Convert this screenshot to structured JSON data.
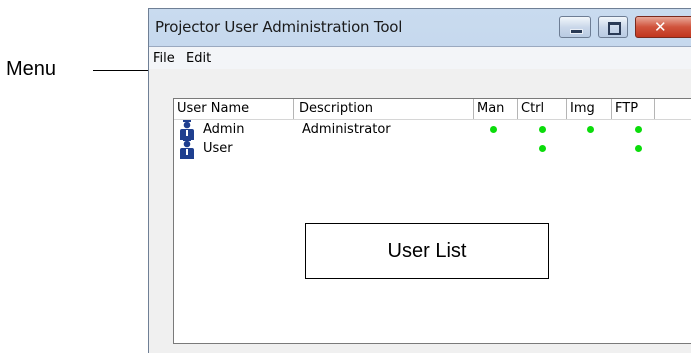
{
  "annotations": {
    "menu_callout": "Menu",
    "user_list_callout": "User List"
  },
  "window": {
    "title": "Projector User Administration Tool",
    "close_glyph": "✕"
  },
  "menubar": {
    "items": [
      "File",
      "Edit"
    ]
  },
  "user_list": {
    "columns": [
      "User Name",
      "Description",
      "Man",
      "Ctrl",
      "Img",
      "FTP"
    ],
    "rows": [
      {
        "name": "Admin",
        "description": "Administrator",
        "man": true,
        "ctrl": true,
        "img": true,
        "ftp": true
      },
      {
        "name": "User",
        "description": "",
        "man": false,
        "ctrl": true,
        "img": false,
        "ftp": true
      }
    ],
    "permission_dot_color": "#0bdc0b",
    "user_icon": "user-icon"
  }
}
